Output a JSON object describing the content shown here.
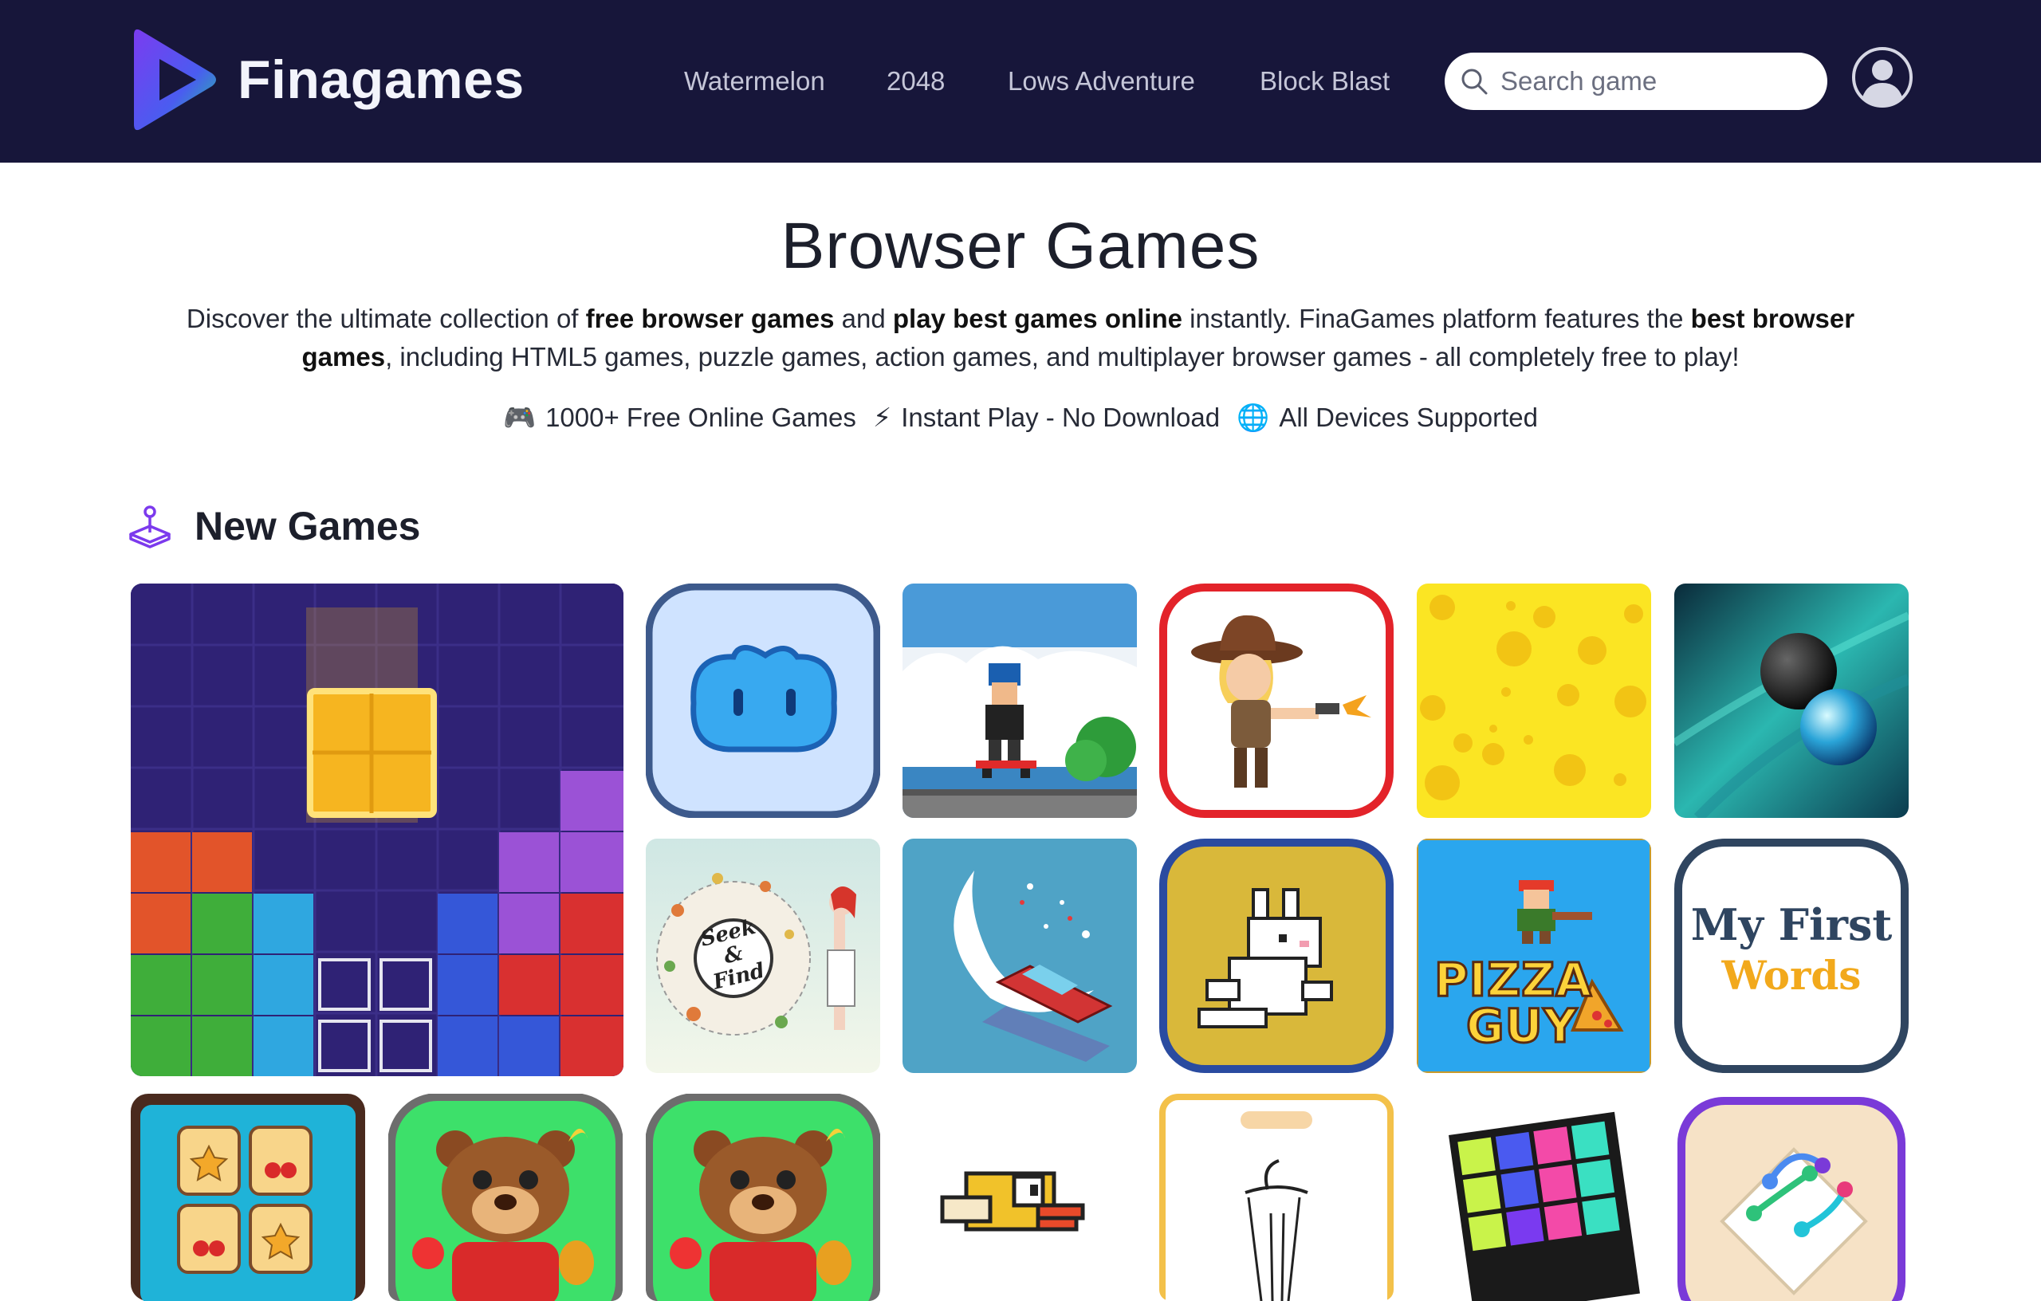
{
  "brand": {
    "name": "Finagames"
  },
  "nav": {
    "items": [
      {
        "label": "Watermelon"
      },
      {
        "label": "2048"
      },
      {
        "label": "Lows Adventure"
      },
      {
        "label": "Block Blast"
      }
    ]
  },
  "search": {
    "placeholder": "Search game",
    "icon": "search-icon"
  },
  "account": {
    "icon": "user-circle-icon"
  },
  "hero": {
    "title": "Browser Games",
    "desc": {
      "p1": "Discover the ultimate collection of ",
      "b1": "free browser games",
      "p2": " and ",
      "b2": "play best games online",
      "p3": " instantly. FinaGames platform features the ",
      "b3": "best browser games",
      "p4": ", including HTML5 games, puzzle games, action games, and multiplayer browser games - all completely free to play!"
    },
    "features": [
      {
        "emoji": "🎮",
        "text": "1000+ Free Online Games"
      },
      {
        "emoji": "⚡",
        "text": "Instant Play - No Download"
      },
      {
        "emoji": "🌐",
        "text": "All Devices Supported"
      }
    ]
  },
  "section": {
    "title": "New Games",
    "icon": "joystick-icon"
  },
  "tiles": {
    "seek_find": "Seek & Find",
    "pizza_guy_1": "PIZZA",
    "pizza_guy_2": "GUY",
    "my_first_words_1": "My First",
    "my_first_words_2": "Words"
  },
  "colors": {
    "header_bg": "#17163a",
    "accent_purple": "#7c3aed",
    "text_dark": "#1c1f2b"
  }
}
